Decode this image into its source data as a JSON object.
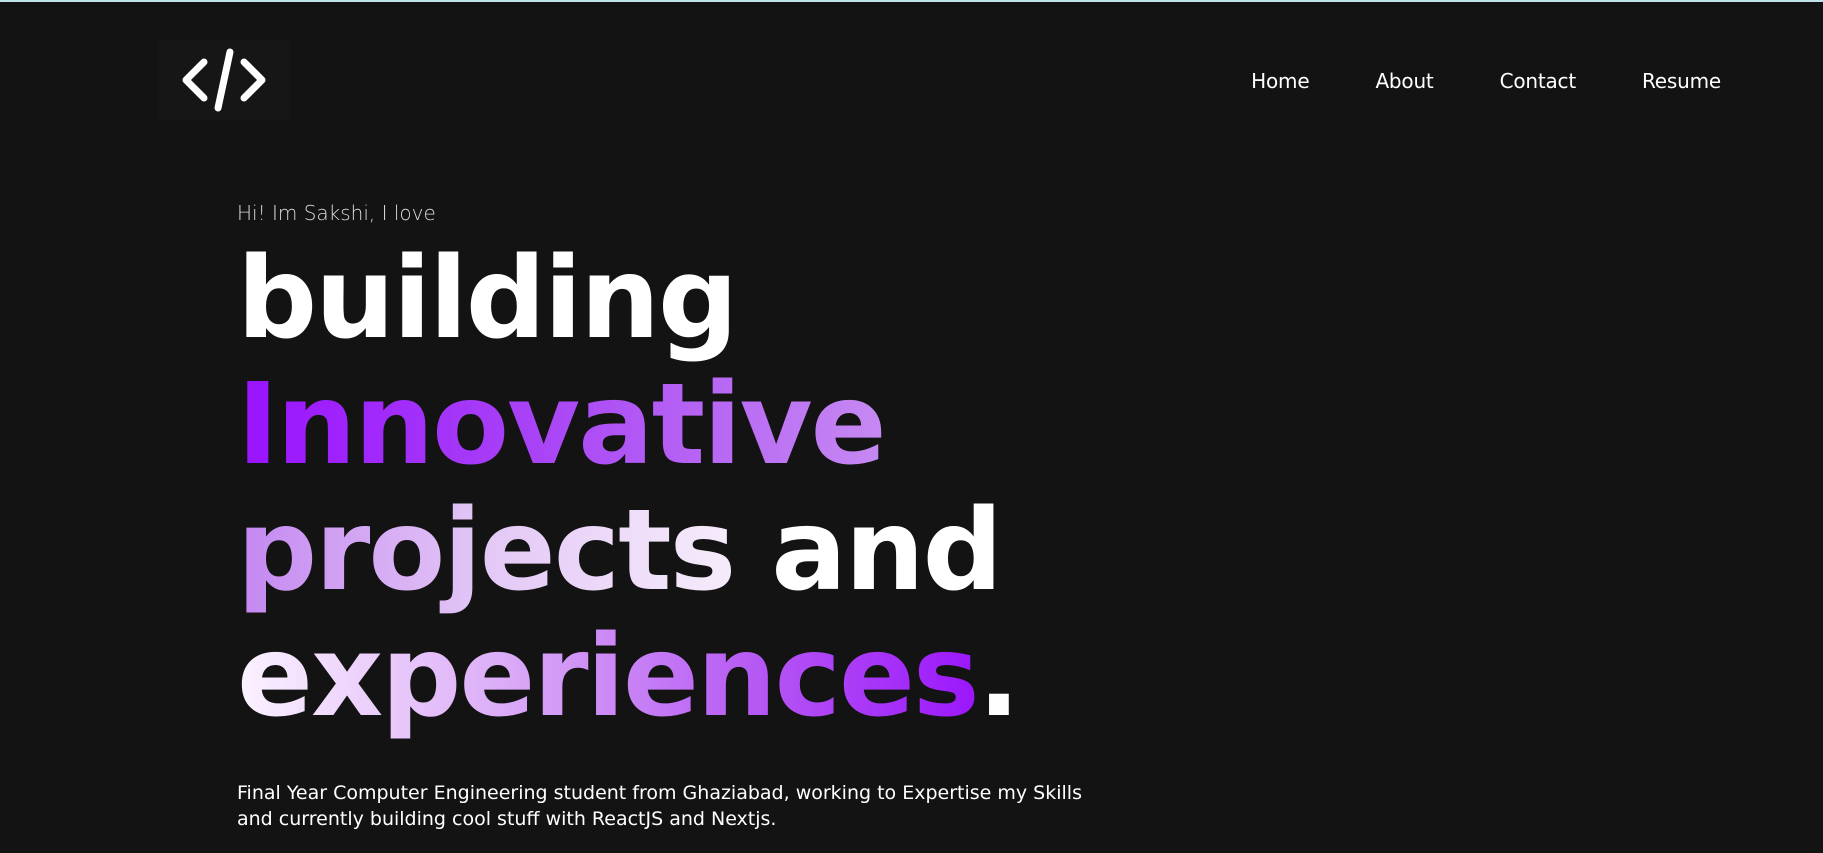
{
  "colors": {
    "background": "#131313",
    "top_accent": "#bfe3ea",
    "accent_purple": "#9a12ff",
    "text": "#ffffff"
  },
  "logo": {
    "icon": "code-brackets-icon",
    "text": "</>"
  },
  "nav": {
    "items": [
      {
        "label": "Home"
      },
      {
        "label": "About"
      },
      {
        "label": "Contact"
      },
      {
        "label": "Resume"
      }
    ]
  },
  "hero": {
    "greeting": "Hi! Im Sakshi, I love",
    "headline": {
      "line1": "building",
      "line2": "Innovative",
      "line3_word1": "projects",
      "line3_word2": " and",
      "line4_word": "experiences",
      "line4_punct": "."
    },
    "bio_line1": "Final Year Computer Engineering student from Ghaziabad, working to Expertise my Skills",
    "bio_line2": "and currently building cool stuff with ReactJS and Nextjs."
  }
}
